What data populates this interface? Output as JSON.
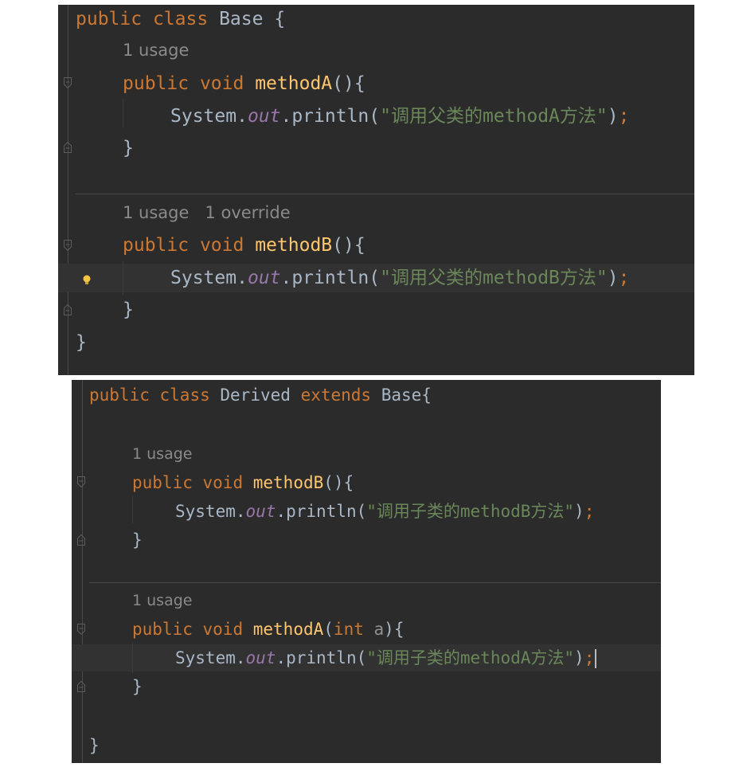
{
  "colors": {
    "background": "#2b2b2b",
    "keyword": "#cc7832",
    "method": "#ffc66d",
    "string": "#6a8759",
    "field": "#9876aa",
    "text": "#a9b7c6",
    "hint": "#8a8a8a"
  },
  "base": {
    "kw_public": "public",
    "kw_class": "class",
    "class_name": "Base",
    "open_brace": "{",
    "close_brace": "}",
    "method_a": {
      "hint": "1 usage",
      "kw_public": "public",
      "kw_void": "void",
      "name": "methodA",
      "parens": "(){",
      "system": "System.",
      "out": "out",
      "println": ".println(",
      "string": "\"调用父类的methodA方法\"",
      "close_paren": ")",
      "semicolon": ";",
      "close_brace": "}"
    },
    "method_b": {
      "hint": "1 usage   1 override",
      "kw_public": "public",
      "kw_void": "void",
      "name": "methodB",
      "parens": "(){",
      "system": "System.",
      "out": "out",
      "println": ".println(",
      "string": "\"调用父类的methodB方法\"",
      "close_paren": ")",
      "semicolon": ";",
      "close_brace": "}"
    }
  },
  "derived": {
    "kw_public": "public",
    "kw_class": "class",
    "class_name": "Derived",
    "kw_extends": "extends",
    "super_name": "Base{",
    "close_brace": "}",
    "method_b": {
      "hint": "1 usage",
      "kw_public": "public",
      "kw_void": "void",
      "name": "methodB",
      "parens": "(){",
      "system": "System.",
      "out": "out",
      "println": ".println(",
      "string": "\"调用子类的methodB方法\"",
      "close_paren": ")",
      "semicolon": ";",
      "close_brace": "}"
    },
    "method_a": {
      "hint": "1 usage",
      "kw_public": "public",
      "kw_void": "void",
      "name": "methodA",
      "open_paren": "(",
      "kw_int": "int",
      "param": "a",
      "close_parens": "){",
      "system": "System.",
      "out": "out",
      "println": ".println(",
      "string": "\"调用子类的methodA方法\"",
      "close_paren": ")",
      "semicolon": ";",
      "close_brace": "}"
    }
  }
}
